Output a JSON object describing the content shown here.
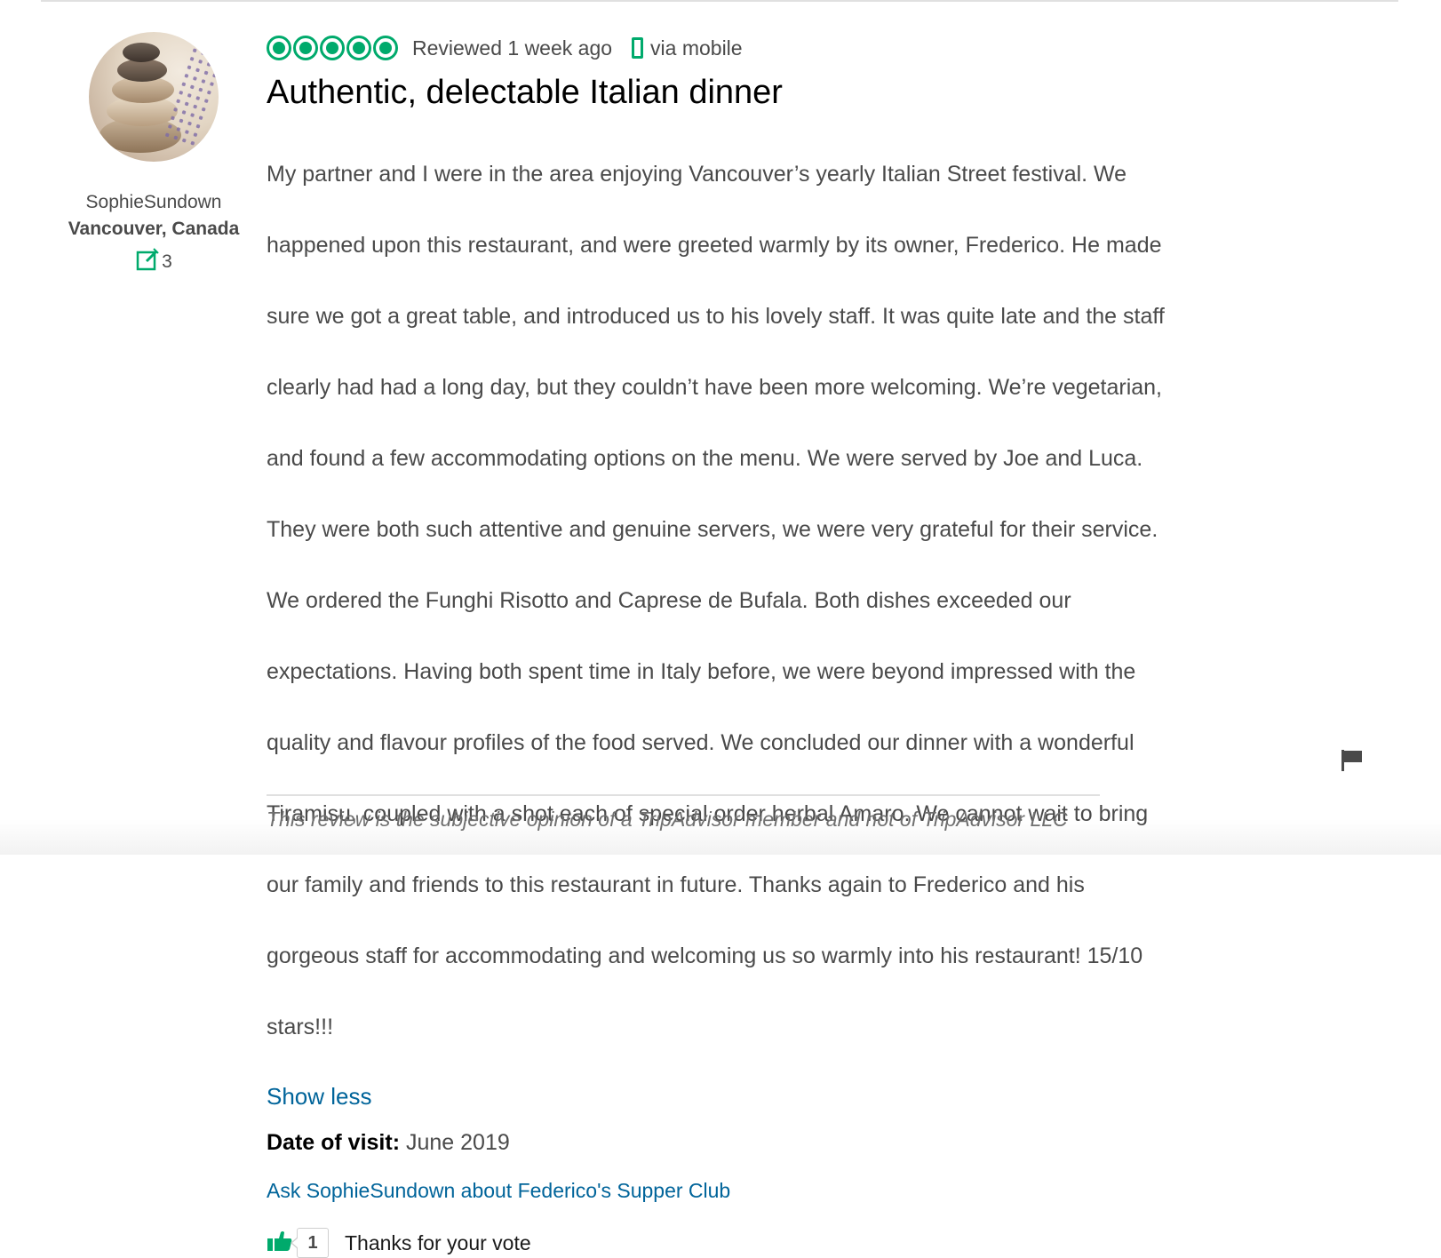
{
  "member": {
    "username": "SophieSundown",
    "location": "Vancouver, Canada",
    "contributions": "3"
  },
  "review": {
    "rating": 5,
    "rating_date": "Reviewed 1 week ago",
    "via": "via mobile",
    "title": "Authentic, delectable Italian dinner",
    "body_lines": [
      "My partner and I were in the area enjoying Vancouver’s yearly Italian Street festival. We",
      "happened upon this restaurant, and were greeted warmly by its owner, Frederico. He made",
      "sure we got a great table, and introduced us to his lovely staff. It was quite late and the staff",
      "clearly had had a long day, but they couldn’t have been more welcoming. We’re vegetarian,",
      "and found a few accommodating options on the menu. We were served by Joe and Luca.",
      "They were both such attentive and genuine servers, we were very grateful for their service.",
      "We ordered the Funghi Risotto and Caprese de Bufala. Both dishes exceeded our",
      "expectations. Having both spent time in Italy before, we were beyond impressed with the",
      "quality and flavour profiles of the food served. We concluded our dinner with a wonderful",
      "Tiramisu, coupled with a shot each of special order herbal Amaro. We cannot wait to bring",
      "our family and friends to this restaurant in future. Thanks again to Frederico and his",
      "gorgeous staff for accommodating and welcoming us so warmly into his restaurant! 15/10",
      "stars!!!"
    ],
    "show_less": "Show less",
    "date_of_visit_label": "Date of visit:",
    "date_of_visit": "June 2019",
    "ask_link": "Ask SophieSundown about Federico's Supper Club",
    "helpful_count": "1",
    "vote_text": "Thanks for your vote"
  },
  "disclaimer": "This review is the subjective opinion of a TripAdvisor member and not of TripAdvisor LLC",
  "colors": {
    "bubble": "#00aa6c",
    "link": "#00649a",
    "text": "#4a4a4a"
  },
  "icons": [
    "avatar-photo",
    "contribution-pencil-icon",
    "mobile-phone-icon",
    "thumbs-up-icon",
    "flag-icon"
  ]
}
